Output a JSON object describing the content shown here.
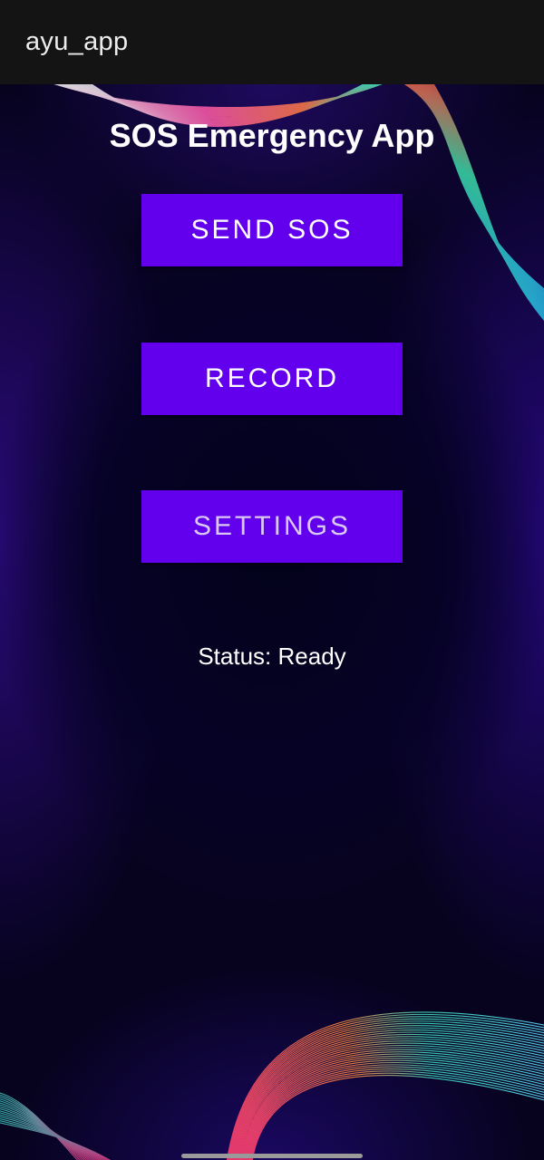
{
  "app_bar": {
    "title": "ayu_app"
  },
  "main": {
    "title": "SOS Emergency App",
    "buttons": {
      "send_sos": "SEND SOS",
      "record": "RECORD",
      "settings": "SETTINGS"
    },
    "status": "Status: Ready"
  },
  "colors": {
    "app_bar": "#141414",
    "button": "#6200ee",
    "background": "#07031f",
    "text": "#ffffff"
  },
  "icons": [
    "wave-lines-decoration"
  ]
}
